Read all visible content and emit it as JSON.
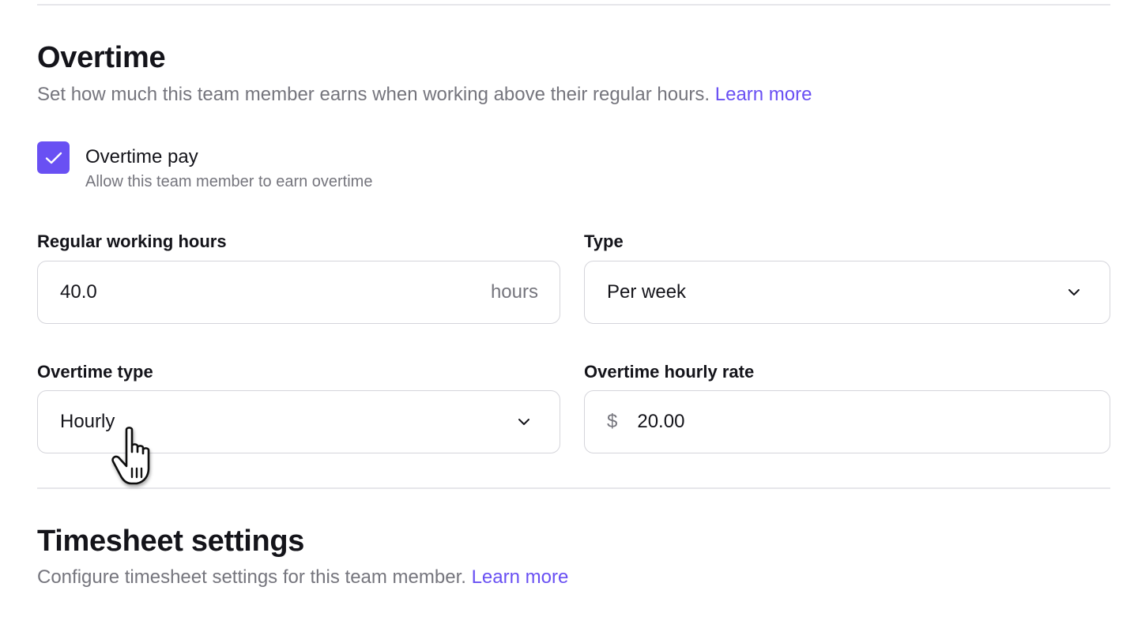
{
  "overtime": {
    "title": "Overtime",
    "description": "Set how much this team member earns when working above their regular hours.",
    "learn_more": "Learn more",
    "overtime_pay": {
      "label": "Overtime pay",
      "hint": "Allow this team member to earn overtime",
      "checked": true
    },
    "regular_hours": {
      "label": "Regular working hours",
      "value": "40.0",
      "suffix": "hours"
    },
    "type": {
      "label": "Type",
      "value": "Per week"
    },
    "overtime_type": {
      "label": "Overtime type",
      "value": "Hourly"
    },
    "overtime_rate": {
      "label": "Overtime hourly rate",
      "prefix": "$",
      "value": "20.00"
    }
  },
  "timesheet": {
    "title": "Timesheet settings",
    "description": "Configure timesheet settings for this team member.",
    "learn_more": "Learn more"
  },
  "colors": {
    "accent": "#6950f3",
    "text_primary": "#14141a",
    "text_secondary": "#75757d",
    "border": "#d5d5db",
    "divider": "#e6e6ea"
  },
  "icons": {
    "checkbox": "check-icon",
    "dropdown": "chevron-down-icon",
    "cursor": "hand-pointer-cursor-icon"
  }
}
